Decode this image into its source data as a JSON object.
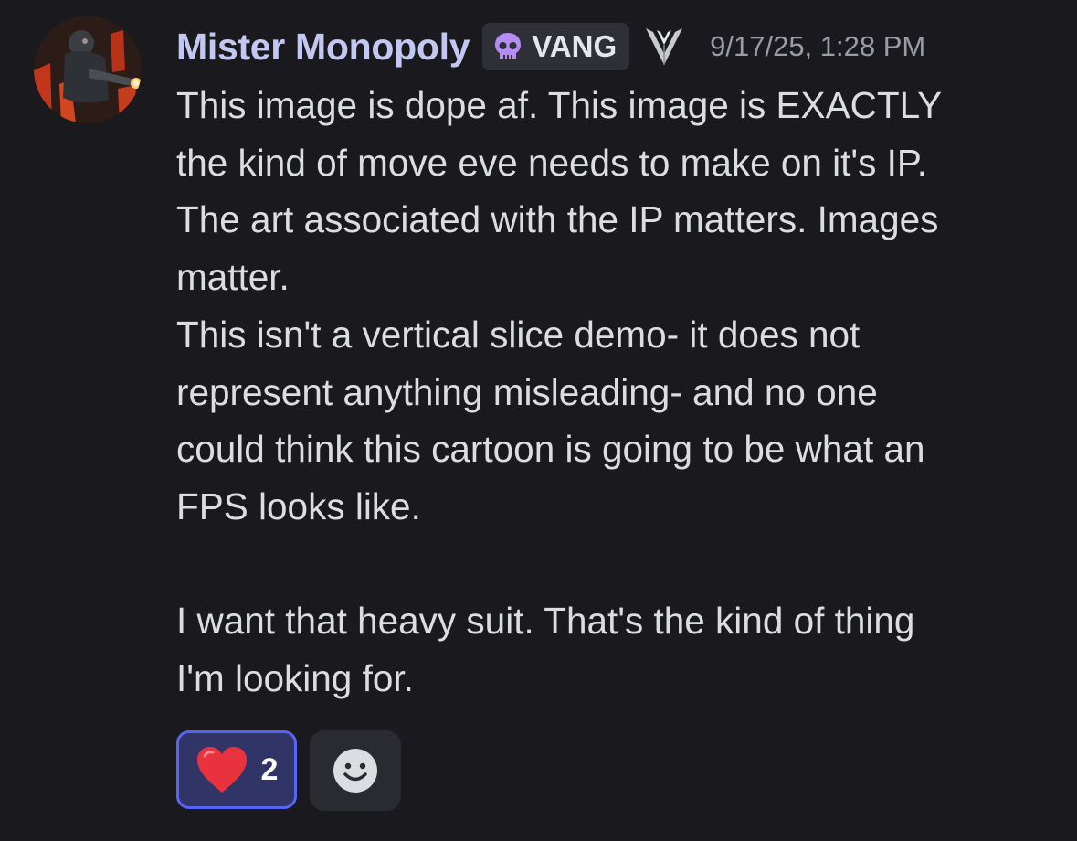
{
  "message": {
    "username": "Mister Monopoly",
    "tag": {
      "icon": "skull-icon",
      "label": "VANG"
    },
    "crest_icon": "alliance-crest-icon",
    "timestamp": "9/17/25, 1:28 PM",
    "lines": [
      "This image is dope af. This image is EXACTLY",
      "the kind of move eve needs to make on it's IP.",
      "The art associated with the IP matters. Images",
      "matter.",
      "This isn't a vertical slice demo- it does not",
      "represent anything misleading- and no one",
      "could think this cartoon is going to be what an",
      "FPS looks like.",
      "",
      "I want that heavy suit. That's the kind of thing",
      "I'm looking for."
    ],
    "reactions": [
      {
        "emoji": "heart-emoji",
        "count": "2",
        "selected": true
      }
    ],
    "add_reaction_icon": "add-reaction-smiley-icon"
  },
  "colors": {
    "background": "#1a1a1e",
    "username": "#c3c8f3",
    "text": "#dbdde1",
    "timestamp": "#9a9ca5",
    "tag_bg": "#2f3037",
    "tag_icon": "#b68cf5",
    "reaction_border": "#5865f2",
    "reaction_bg": "#313466",
    "heart": "#e8333f"
  }
}
